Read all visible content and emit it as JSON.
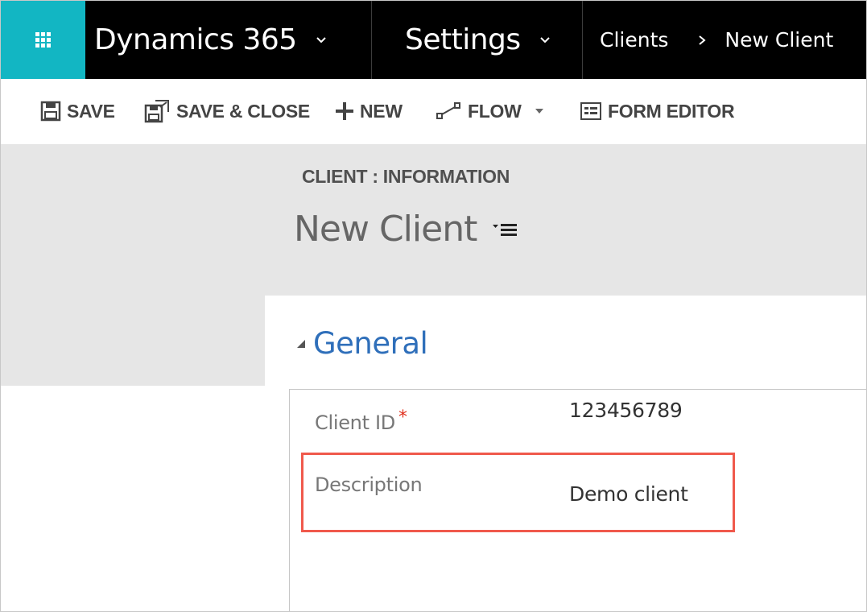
{
  "topnav": {
    "app_name": "Dynamics 365",
    "area_name": "Settings",
    "breadcrumb": {
      "parent": "Clients",
      "current": "New Client"
    }
  },
  "commands": {
    "save": "SAVE",
    "save_close": "SAVE & CLOSE",
    "new": "NEW",
    "flow": "FLOW",
    "form_editor": "FORM EDITOR"
  },
  "header": {
    "entity_form": "CLIENT : INFORMATION",
    "record_title": "New Client"
  },
  "section": {
    "title": "General",
    "fields": {
      "client_id": {
        "label": "Client ID",
        "required_marker": "*",
        "value": "123456789"
      },
      "description": {
        "label": "Description",
        "value": "Demo client"
      }
    }
  },
  "colors": {
    "waffle": "#12b6c3",
    "topnav": "#000000",
    "section_title": "#2f6fba",
    "highlight_border": "#f0594c",
    "required": "#e0301e"
  },
  "icons": [
    "app-launcher-icon",
    "chevron-down-icon",
    "save-icon",
    "save-close-icon",
    "plus-icon",
    "flow-icon",
    "caret-down-icon",
    "form-editor-icon",
    "title-menu-icon",
    "collapse-triangle-icon"
  ]
}
